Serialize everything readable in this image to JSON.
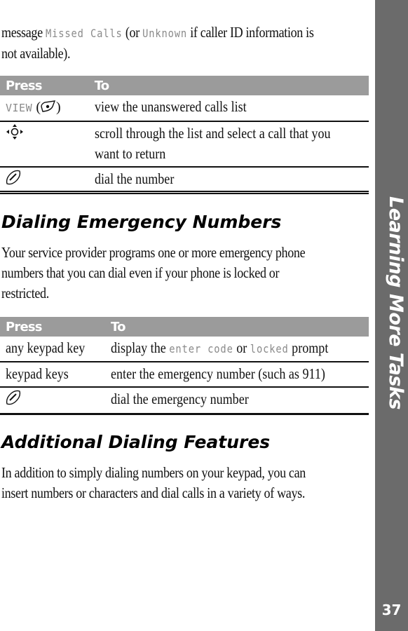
{
  "intro": {
    "prefix": "message ",
    "display_missed": "Missed Calls",
    "middle": " (or ",
    "display_unknown": "Unknown",
    "suffix_line1": " if caller ID information is",
    "line2": "not available)."
  },
  "table1": {
    "header_press": "Press",
    "header_to": "To",
    "rows": [
      {
        "press_key": "VIEW",
        "press_icon": "soft-key-icon",
        "to": "view the unanswered calls list"
      },
      {
        "press_icon": "navigation-key-icon",
        "to_line1": "scroll through the list and select a call that you",
        "to_line2": "want to return"
      },
      {
        "press_icon": "send-key-icon",
        "to": "dial the number"
      }
    ]
  },
  "section1": {
    "heading": "Dialing Emergency Numbers",
    "body_line1": "Your service provider programs one or more emergency phone",
    "body_line2": "numbers that you can dial even if your phone is locked or",
    "body_line3": "restricted."
  },
  "table2": {
    "header_press": "Press",
    "header_to": "To",
    "rows": [
      {
        "press": "any keypad key",
        "to_prefix": "display the ",
        "display_enter_code": "enter code",
        "to_middle": " or ",
        "display_locked": "locked",
        "to_suffix": " prompt"
      },
      {
        "press": "keypad keys",
        "to": "enter the emergency number (such as 911)"
      },
      {
        "press_icon": "send-key-icon",
        "to": "dial the emergency number"
      }
    ]
  },
  "section2": {
    "heading": "Additional Dialing Features",
    "body_line1": "In addition to simply dialing numbers on your keypad, you can",
    "body_line2": "insert numbers or characters and dial calls in a variety of ways."
  },
  "sidebar": {
    "chapter_title": "Learning More Tasks",
    "page_number": "37",
    "color": "#6b6b6b"
  }
}
